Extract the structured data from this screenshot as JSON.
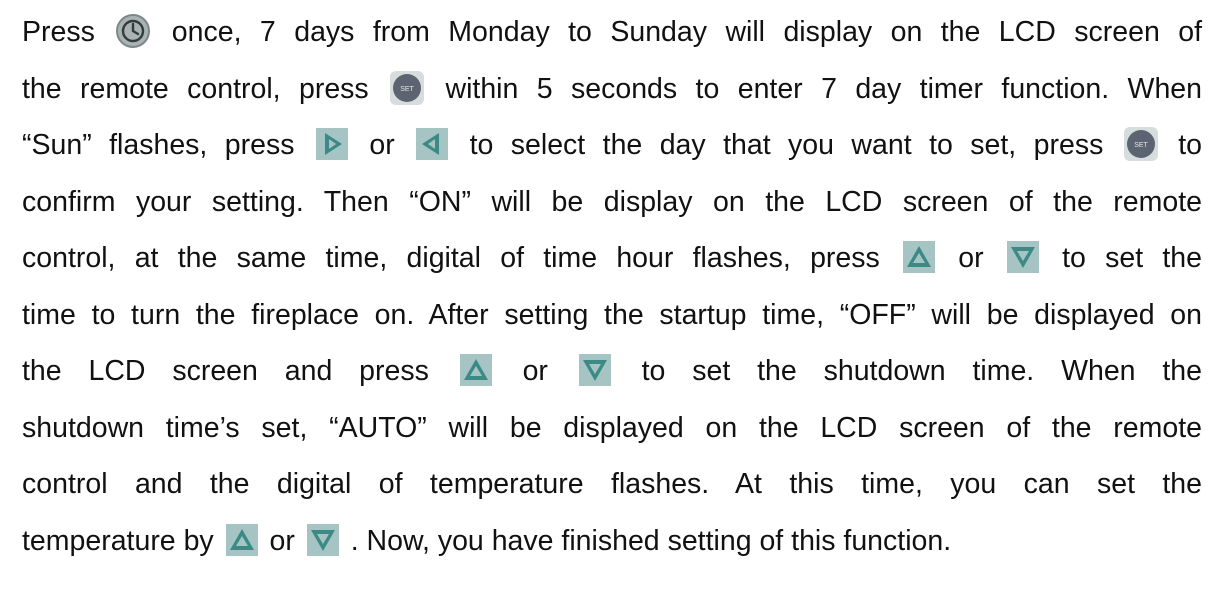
{
  "icons": {
    "clock": "clock-icon",
    "set": "set-button-icon",
    "right": "right-triangle-icon",
    "left": "left-triangle-icon",
    "up": "up-triangle-icon",
    "down": "down-triangle-icon",
    "set_label": "SET"
  },
  "colors": {
    "text": "#111111",
    "clock_fill": "#aab2b2",
    "set_fill": "#5b6470",
    "arrow_fill": "#3c8a86",
    "arrow_bg": "#a7c4c4"
  },
  "lines": [
    {
      "a": "Press",
      "b": "once, 7 days from Monday to Sunday will display on the LCD screen of"
    },
    {
      "a": "the remote control, press",
      "b": "within 5 seconds to enter 7 day timer function. When"
    },
    {
      "a": "“Sun” flashes, press",
      "b": "or",
      "c": "to select the day that you want to set, press",
      "d": "to"
    },
    {
      "a": "confirm your setting. Then “ON” will be display on the LCD screen of the remote"
    },
    {
      "a": "control, at the same time, digital of time hour flashes, press",
      "b": "or",
      "c": "to set the"
    },
    {
      "a": "time to turn the fireplace on. After setting the startup time, “OFF” will be displayed on"
    },
    {
      "a": "the LCD screen and press",
      "b": "or",
      "c": "to set the shutdown time.  When the"
    },
    {
      "a": "shutdown time’s set, “AUTO” will be displayed on the LCD screen of the remote"
    },
    {
      "a": "control and the digital of temperature flashes. At this time, you can set the"
    },
    {
      "a": "temperature by",
      "b": "or",
      "c": ". Now, you have finished setting of this function."
    }
  ]
}
